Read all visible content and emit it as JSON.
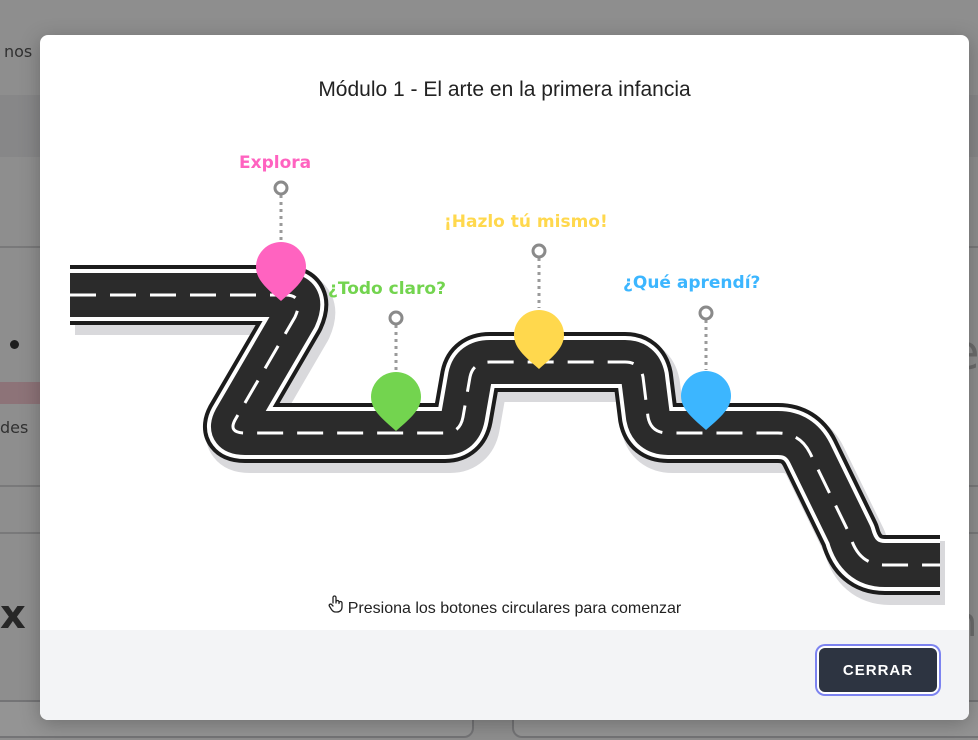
{
  "background": {
    "top_text": "nos",
    "side_text": "des",
    "big_letter_left": "x",
    "big_letter_right_top": "e",
    "big_letter_right_bottom": "n"
  },
  "modal": {
    "title": "Módulo 1 - El arte en la primera infancia",
    "stops": [
      {
        "label": "Explora",
        "color": "#ff63c0"
      },
      {
        "label": "¿Todo claro?",
        "color": "#73d44f"
      },
      {
        "label": "¡Hazlo tú mismo!",
        "color": "#ffd84d"
      },
      {
        "label": "¿Qué aprendí?",
        "color": "#3cb6ff"
      }
    ],
    "hint_icon": "hand-pointer-icon",
    "hint": "Presiona los botones circulares para comenzar",
    "close_label": "CERRAR"
  },
  "colors": {
    "road": "#2b2b2b",
    "road_border": "#ffffff",
    "close_button": "#2d3441",
    "focus_ring": "#7c83f0"
  }
}
